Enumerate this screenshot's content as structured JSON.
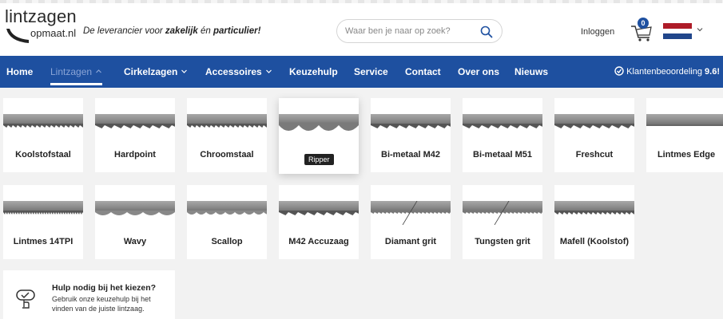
{
  "brand": {
    "logo_top": "lintzagen",
    "logo_bottom": "opmaat.nl",
    "tagline_prefix": "De leverancier voor ",
    "tagline_b1": "zakelijk",
    "tagline_mid": " én ",
    "tagline_b2": "particulier!"
  },
  "search": {
    "placeholder": "Waar ben je naar op zoek?"
  },
  "account": {
    "login_label": "Inloggen",
    "cart_count": "0"
  },
  "colors": {
    "primary": "#1e50a0",
    "flag_red": "#ae1c28",
    "flag_white": "#ffffff",
    "flag_blue": "#21468b"
  },
  "nav": {
    "items": [
      {
        "label": "Home"
      },
      {
        "label": "Lintzagen",
        "active": true
      },
      {
        "label": "Cirkelzagen"
      },
      {
        "label": "Accessoires"
      },
      {
        "label": "Keuzehulp"
      },
      {
        "label": "Service"
      },
      {
        "label": "Contact"
      },
      {
        "label": "Over ons"
      },
      {
        "label": "Nieuws"
      }
    ],
    "rating_label": "Klantenbeoordeling ",
    "rating_value": "9.6!"
  },
  "products": [
    {
      "label": "Koolstofstaal"
    },
    {
      "label": "Hardpoint"
    },
    {
      "label": "Chroomstaal"
    },
    {
      "label": "Ripper"
    },
    {
      "label": "Bi-metaal M42"
    },
    {
      "label": "Bi-metaal M51"
    },
    {
      "label": "Freshcut"
    },
    {
      "label": "Lintmes Edge"
    },
    {
      "label": "Lintmes 14TPI"
    },
    {
      "label": "Wavy"
    },
    {
      "label": "Scallop"
    },
    {
      "label": "M42 Accuzaag"
    },
    {
      "label": "Diamant grit"
    },
    {
      "label": "Tungsten grit"
    },
    {
      "label": "Mafell (Koolstof)"
    }
  ],
  "help": {
    "title": "Hulp nodig bij het kiezen?",
    "text": "Gebruik onze keuzehulp bij het vinden van de juiste lintzaag."
  }
}
